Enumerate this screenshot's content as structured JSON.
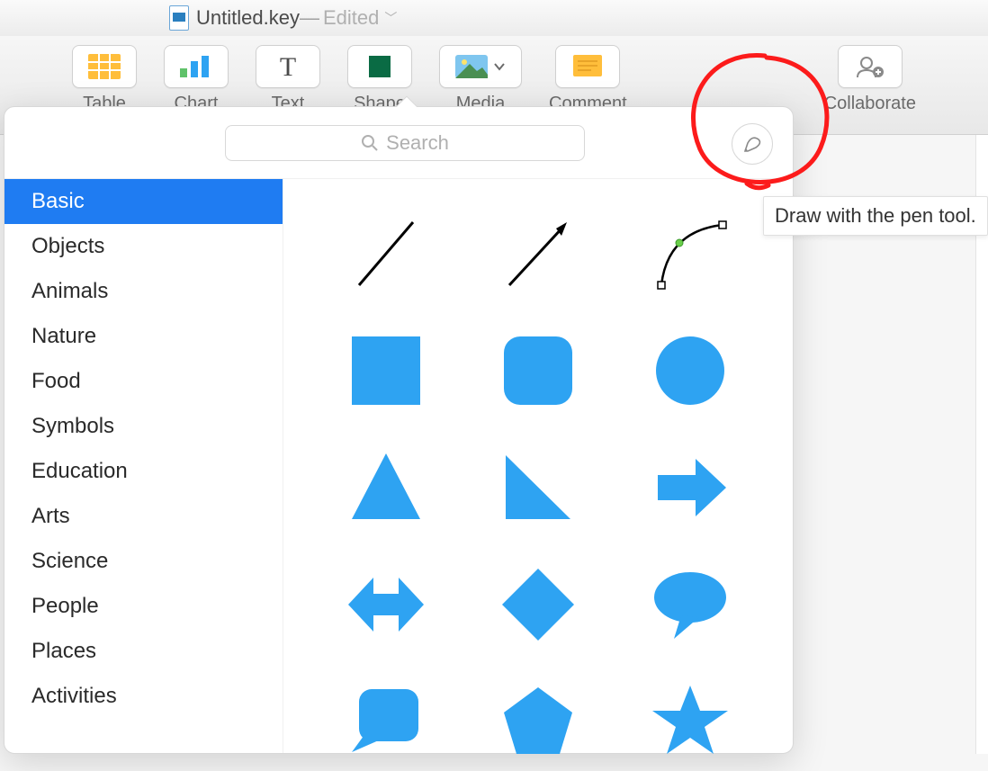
{
  "titlebar": {
    "filename": "Untitled.key",
    "separator": " — ",
    "edited": "Edited"
  },
  "toolbar": {
    "table": "Table",
    "chart": "Chart",
    "text": "Text",
    "shape": "Shape",
    "media": "Media",
    "comment": "Comment",
    "collaborate": "Collaborate"
  },
  "search": {
    "placeholder": "Search"
  },
  "pen_tooltip": "Draw with the pen tool.",
  "sidebar": {
    "items": [
      "Basic",
      "Objects",
      "Animals",
      "Nature",
      "Food",
      "Symbols",
      "Education",
      "Arts",
      "Science",
      "People",
      "Places",
      "Activities"
    ],
    "selected_index": 0
  },
  "shapes": [
    "line",
    "arrow-line",
    "curve-path",
    "square",
    "rounded-square",
    "circle",
    "triangle",
    "right-triangle",
    "arrow-right",
    "arrow-both",
    "diamond",
    "speech-bubble",
    "callout",
    "pentagon",
    "star"
  ],
  "colors": {
    "shape": "#2ea3f2",
    "accent": "#1f7cf2"
  }
}
